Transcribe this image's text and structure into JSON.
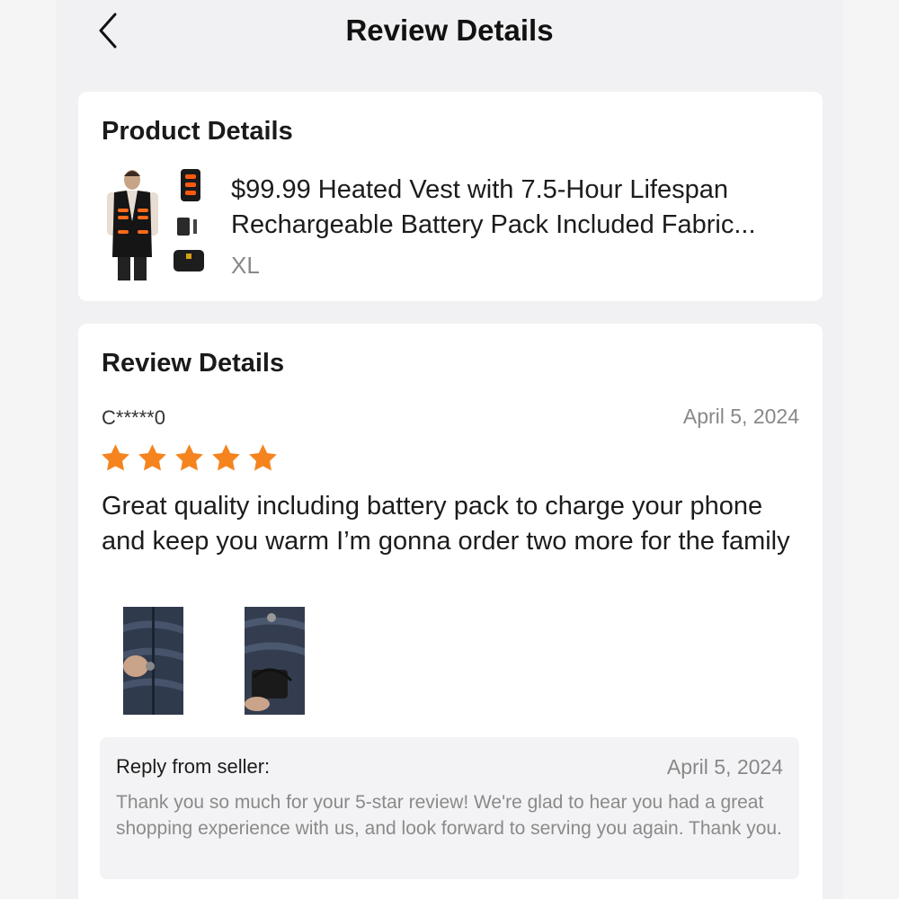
{
  "header": {
    "title": "Review Details",
    "back_icon": "chevron-left-icon"
  },
  "product_card": {
    "title": "Product Details",
    "name": "$99.99 Heated Vest with 7.5-Hour Lifespan Rechargeable Battery Pack Included Fabric...",
    "variant": "XL",
    "thumbnail_icon": "heated-vest-product-image"
  },
  "review_card": {
    "title": "Review Details",
    "reviewer": "C*****0",
    "date": "April 5, 2024",
    "rating": 5,
    "star_color": "#f5841f",
    "text": "Great quality including battery pack to charge your phone and keep you warm I’m gonna order two more for the family",
    "photos": [
      "review-photo-1",
      "review-photo-2"
    ],
    "reply": {
      "label": "Reply from seller:",
      "date": "April 5, 2024",
      "text": "Thank you so much for your 5-star review! We're glad to hear you had a great shopping experience with us, and look forward to serving you again. Thank you."
    }
  }
}
